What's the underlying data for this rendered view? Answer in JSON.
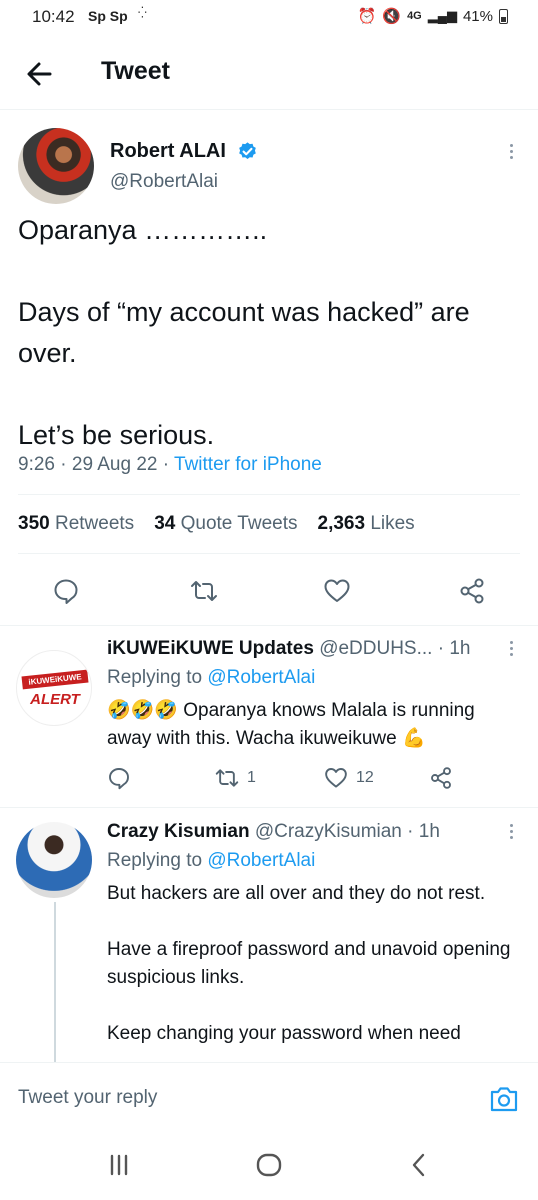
{
  "status_bar": {
    "time": "10:42",
    "carrier": "Sp Sp",
    "network": "4G",
    "battery": "41%"
  },
  "header": {
    "title": "Tweet"
  },
  "tweet": {
    "author_name": "Robert ALAI",
    "author_handle": "@RobertAlai",
    "text": "Oparanya …………..\n\nDays of “my account was hacked” are over.\n\nLet’s be serious.",
    "time": "9:26",
    "date": "29 Aug 22",
    "source": "Twitter for iPhone",
    "stats": {
      "retweets_count": "350",
      "retweets_label": "Retweets",
      "quotes_count": "34",
      "quotes_label": "Quote Tweets",
      "likes_count": "2,363",
      "likes_label": "Likes"
    }
  },
  "replies": [
    {
      "name": "iKUWEiKUWE Updates",
      "handle": "@eDDUHS...",
      "age": "· 1h",
      "replying_prefix": "Replying to",
      "replying_to": "@RobertAlai",
      "text": "🤣🤣🤣 Oparanya knows Malala is running away with this. Wacha ikuweikuwe 💪",
      "retweets": "1",
      "likes": "12",
      "avatar_band": "iKUWEiKUWE",
      "avatar_alert": "ALERT"
    },
    {
      "name": "Crazy Kisumian",
      "handle": "@CrazyKisumian",
      "age": "· 1h",
      "replying_prefix": "Replying to",
      "replying_to": "@RobertAlai",
      "text": "But hackers are all over and they do not rest.\n\nHave a fireproof password and unavoid opening suspicious links.\n\nKeep changing your password when need"
    }
  ],
  "reply_bar": {
    "placeholder": "Tweet your reply"
  },
  "icons": {
    "back": "arrow-left-icon",
    "verified": "verified-badge-icon",
    "more": "more-vertical-icon",
    "reply": "comment-icon",
    "retweet": "retweet-icon",
    "like": "heart-icon",
    "share": "share-icon",
    "camera": "camera-icon"
  },
  "colors": {
    "accent": "#1d9bf0",
    "text": "#0f1419",
    "muted": "#536471"
  }
}
